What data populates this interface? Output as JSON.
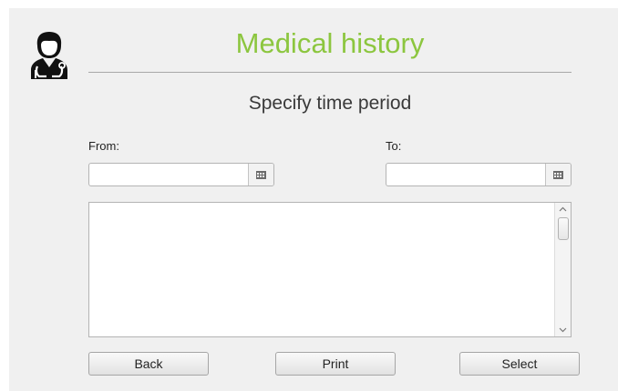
{
  "header": {
    "title": "Medical history",
    "avatar_icon": "doctor-avatar-icon",
    "title_color": "#8cc63f"
  },
  "period": {
    "heading": "Specify time period",
    "from": {
      "label": "From:",
      "value": "",
      "button_icon": "calendar-icon"
    },
    "to": {
      "label": "To:",
      "value": "",
      "button_icon": "calendar-icon"
    }
  },
  "results": {
    "items": [],
    "scroll_up_icon": "chevron-up-icon",
    "scroll_down_icon": "chevron-down-icon"
  },
  "actions": {
    "back_label": "Back",
    "print_label": "Print",
    "select_label": "Select"
  }
}
